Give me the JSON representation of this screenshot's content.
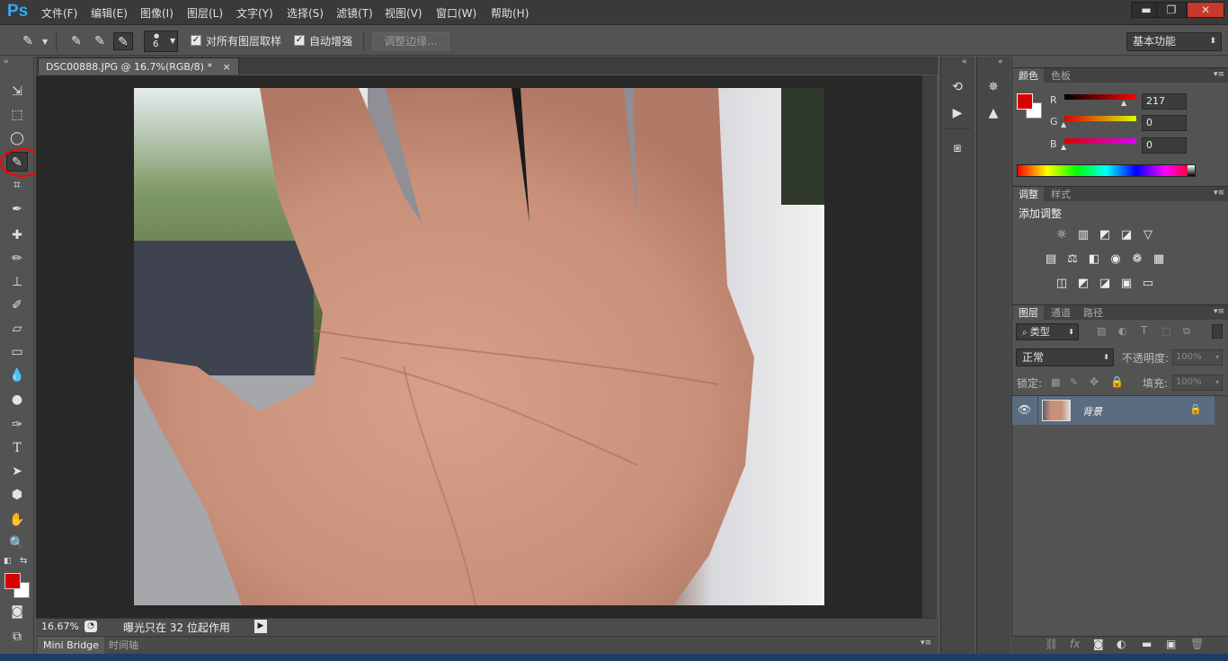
{
  "app": {
    "logo": "Ps",
    "menu": [
      "文件(F)",
      "编辑(E)",
      "图像(I)",
      "图层(L)",
      "文字(Y)",
      "选择(S)",
      "滤镜(T)",
      "视图(V)",
      "窗口(W)",
      "帮助(H)"
    ],
    "window_buttons": [
      "▬",
      "❐",
      "✕"
    ]
  },
  "options": {
    "brush_size": "6",
    "sample_all_layers_label": "对所有图层取样",
    "auto_enhance_label": "自动增强",
    "refine_edge_label": "调整边缘...",
    "workspace": "基本功能"
  },
  "document": {
    "tab_title": "DSC00888.JPG @ 16.7%(RGB/8) *",
    "tab_close": "×",
    "zoom": "16.67%",
    "status_text": "曝光只在 32 位起作用"
  },
  "bottom_tabs": [
    "Mini Bridge",
    "时间轴"
  ],
  "color_panel": {
    "tabs": [
      "颜色",
      "色板"
    ],
    "channels": [
      {
        "label": "R",
        "value": "217"
      },
      {
        "label": "G",
        "value": "0"
      },
      {
        "label": "B",
        "value": "0"
      }
    ],
    "foreground": "#d90000",
    "background": "#ffffff"
  },
  "adjust_panel": {
    "tabs": [
      "调整",
      "样式"
    ],
    "title": "添加调整"
  },
  "layers_panel": {
    "tabs": [
      "图层",
      "通道",
      "路径"
    ],
    "filter_label": "类型",
    "blend_mode": "正常",
    "opacity_label": "不透明度:",
    "opacity_value": "100%",
    "lock_label": "锁定:",
    "fill_label": "填充:",
    "fill_value": "100%",
    "layers": [
      {
        "name": "背景",
        "visible": true,
        "locked": true
      }
    ]
  },
  "colors": {
    "accent_ps": "#31a8ff",
    "annotation_circle": "#ff0000"
  }
}
